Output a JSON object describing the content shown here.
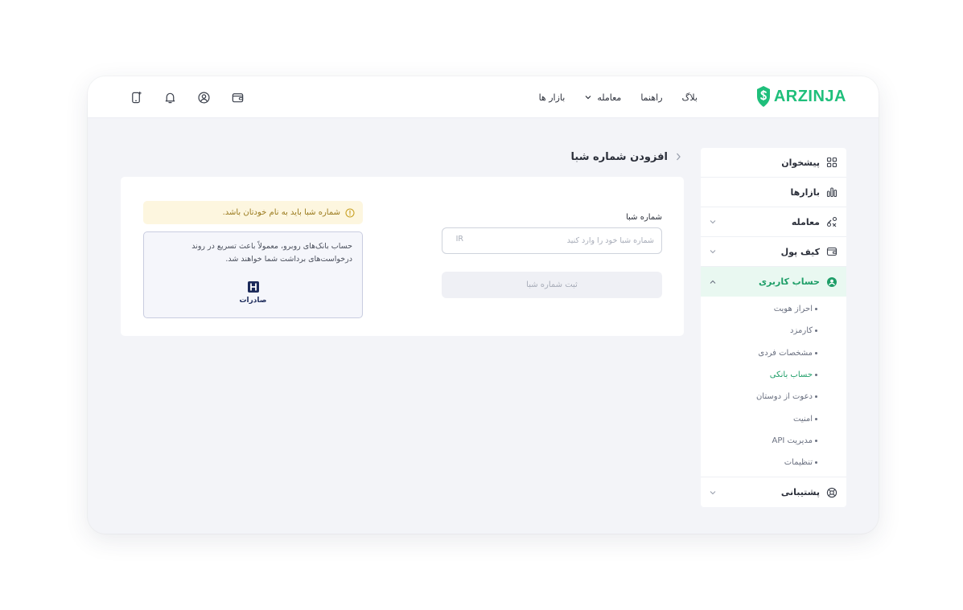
{
  "brand": {
    "name": "ARZINJA",
    "color": "#1fbf7b"
  },
  "nav": {
    "items": [
      {
        "label": "بازار ها",
        "dropdown": false
      },
      {
        "label": "معامله",
        "dropdown": true
      },
      {
        "label": "راهنما",
        "dropdown": false
      },
      {
        "label": "بلاگ",
        "dropdown": false
      }
    ]
  },
  "header_icons": [
    "wallet-icon",
    "user-circle-icon",
    "bell-icon",
    "mobile-icon"
  ],
  "sidebar": {
    "items": [
      {
        "label": "پیشخوان",
        "icon": "grid-icon"
      },
      {
        "label": "بازارها",
        "icon": "bar-chart-icon"
      },
      {
        "label": "معامله",
        "icon": "exchange-icon"
      },
      {
        "label": "کیف پول",
        "icon": "wallet-icon"
      },
      {
        "label": "حساب کاربری",
        "icon": "user-circle-icon"
      },
      {
        "label": "پشتیبانی",
        "icon": "lifebuoy-icon"
      }
    ],
    "submenu": [
      "احراز هویت",
      "کارمزد",
      "مشخصات فردی",
      "حساب بانکی",
      "دعوت از دوستان",
      "امنیت",
      "مدیریت API",
      "تنظیمات"
    ],
    "active_item": "حساب کاربری",
    "active_subitem": "حساب بانکی",
    "accent": "#1e9e68"
  },
  "page": {
    "title": "افزودن شماره شبا"
  },
  "form": {
    "label": "شماره شبا",
    "placeholder": "شماره شبا خود را وارد کنید",
    "prefix": "IR",
    "submit_label": "ثبت شماره شبا"
  },
  "notice": {
    "warning": "شماره شبا باید به نام خودتان باشد.",
    "bank_description": "حساب بانک‌های روبرو، معمولاً باعث تسریع در روند درخواست‌های برداشت شما خواهند شد.",
    "bank_name": "صادرات",
    "warning_color": "#9a7a1d"
  }
}
